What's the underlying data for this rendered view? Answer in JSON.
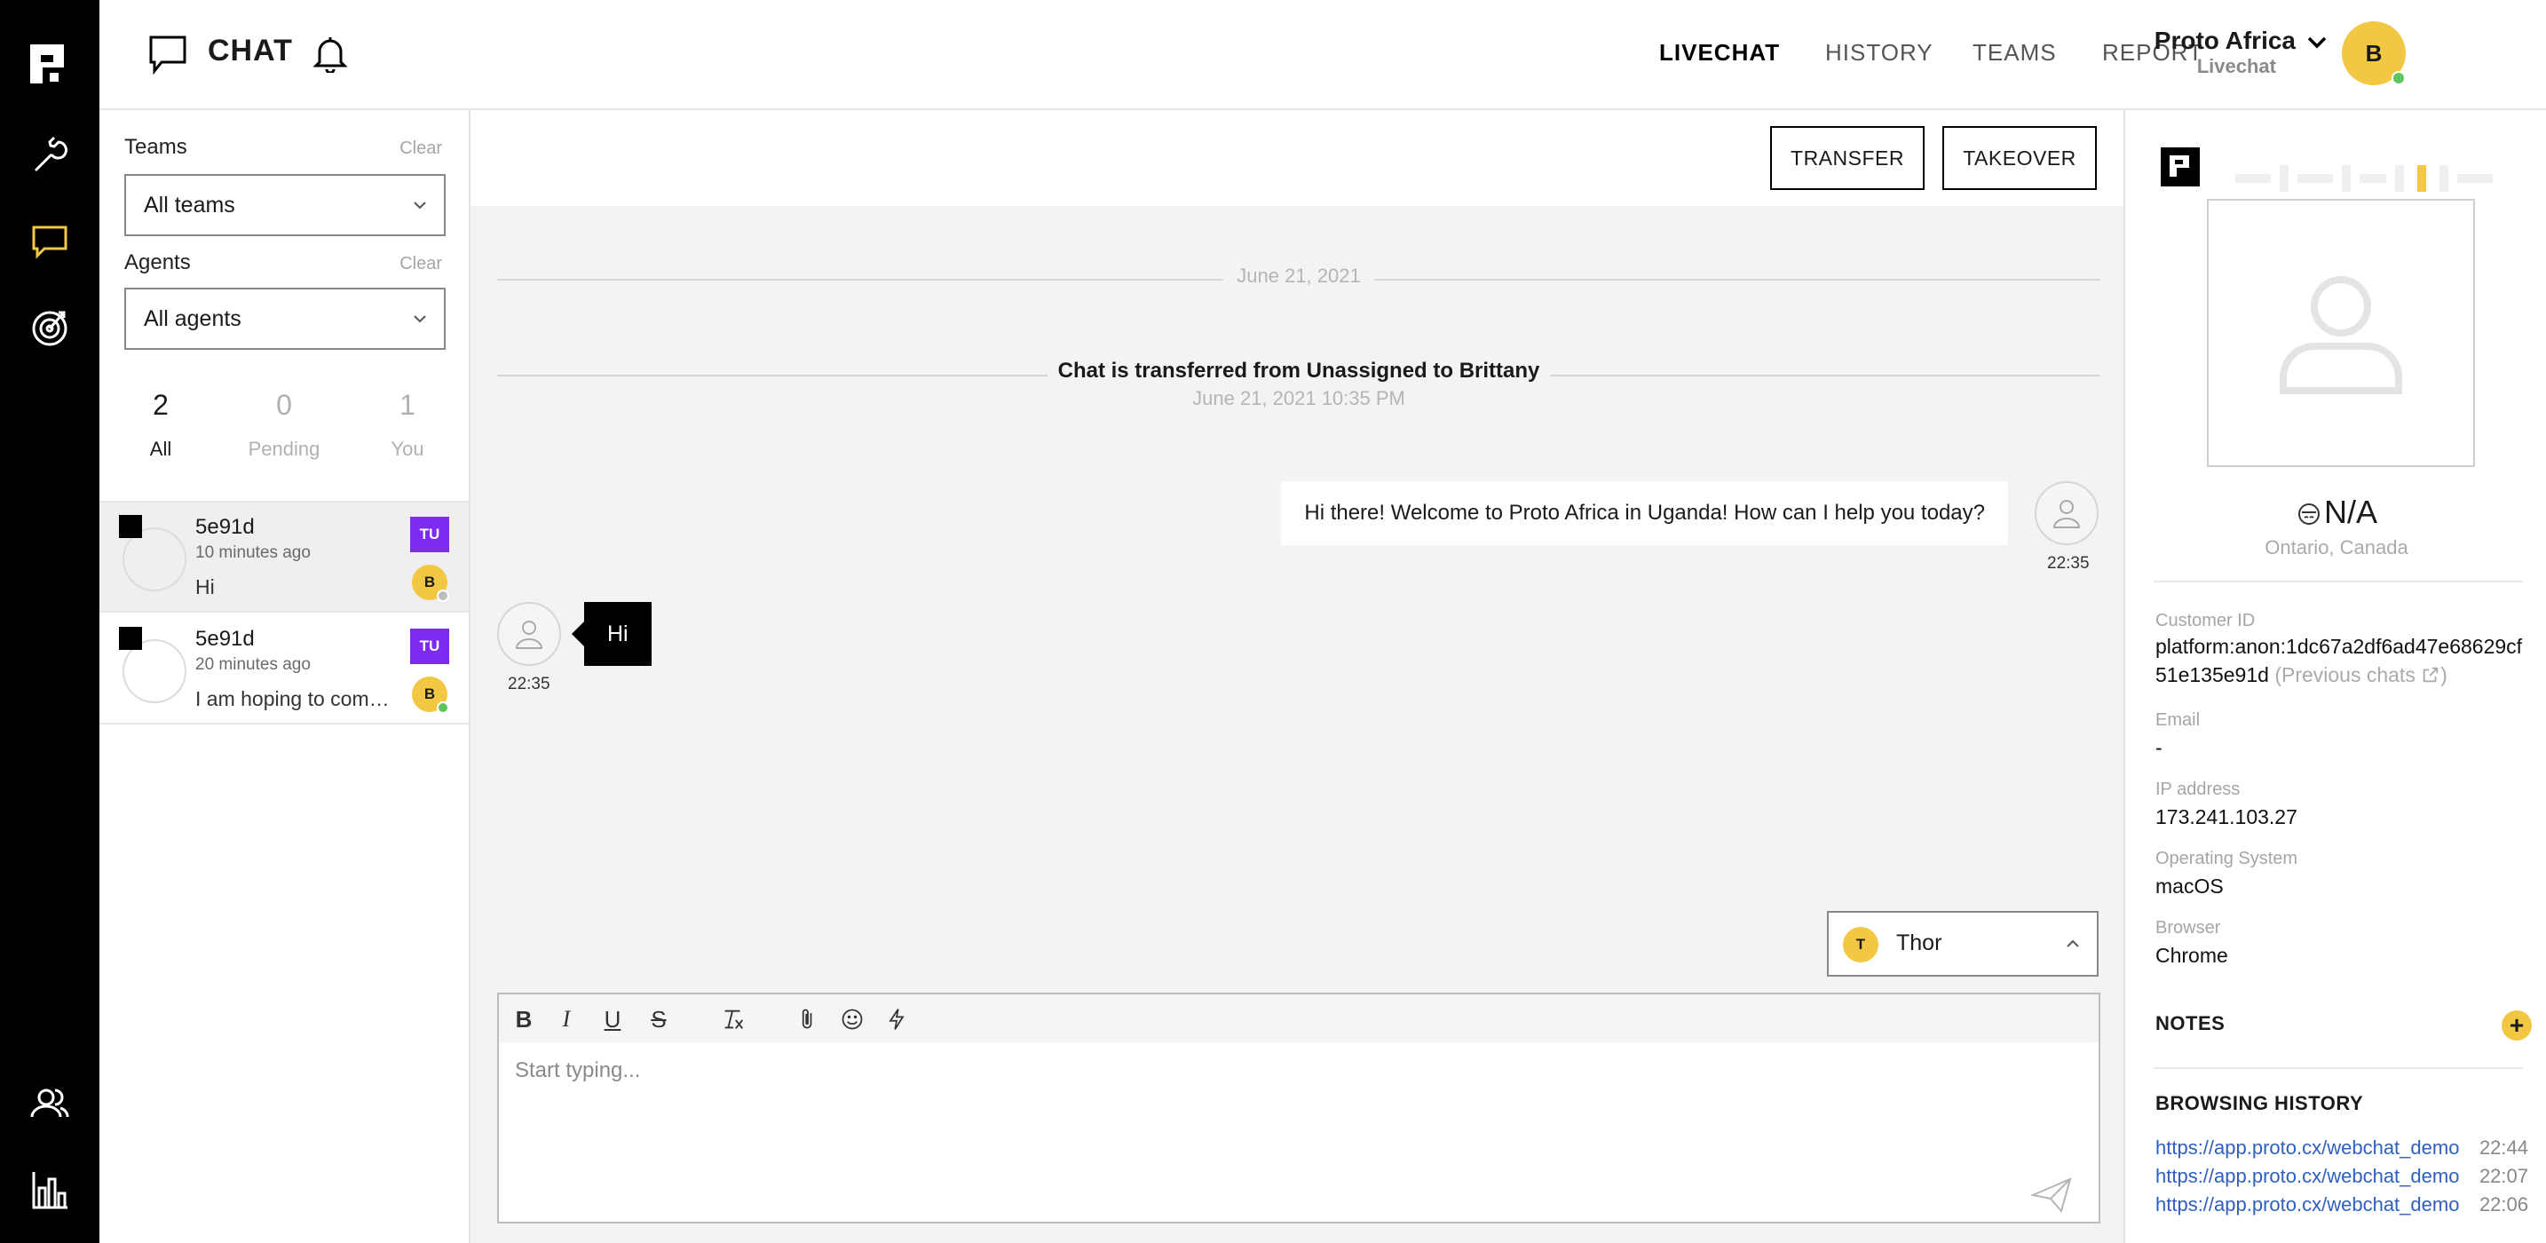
{
  "header": {
    "title": "CHAT",
    "nav": [
      "LIVECHAT",
      "HISTORY",
      "TEAMS",
      "REPORT"
    ],
    "org_name": "Proto Africa",
    "org_sub": "Livechat",
    "user_initial": "B"
  },
  "filters": {
    "teams_label": "Teams",
    "teams_clear": "Clear",
    "teams_value": "All teams",
    "agents_label": "Agents",
    "agents_clear": "Clear",
    "agents_value": "All agents",
    "counts": [
      {
        "num": "2",
        "label": "All"
      },
      {
        "num": "0",
        "label": "Pending"
      },
      {
        "num": "1",
        "label": "You"
      }
    ]
  },
  "conversations": [
    {
      "id": "5e91d",
      "time": "10 minutes ago",
      "preview": "Hi",
      "team": "TU",
      "agent": "B",
      "status_color": "#bdbdbd"
    },
    {
      "id": "5e91d",
      "time": "20 minutes ago",
      "preview": "I am hoping to come to Uganda",
      "team": "TU",
      "agent": "B",
      "status_color": "#5cc560"
    }
  ],
  "chat": {
    "transfer_label": "TRANSFER",
    "takeover_label": "TAKEOVER",
    "date": "June 21, 2021",
    "system_message": "Chat is transferred from Unassigned to Brittany",
    "system_date": "June 21, 2021 10:35 PM",
    "outgoing": {
      "text": "Hi there! Welcome to Proto Africa in Uganda! How can I help you today?",
      "time": "22:35"
    },
    "incoming": {
      "text": "Hi",
      "time": "22:35"
    },
    "assignee_initial": "T",
    "assignee_name": "Thor",
    "composer_placeholder": "Start typing..."
  },
  "customer": {
    "name": "N/A",
    "location": "Ontario, Canada",
    "customer_id_label": "Customer ID",
    "customer_id": "platform:anon:1dc67a2df6ad47e68629cf51e135e91d",
    "previous_chats": "(Previous chats",
    "email_label": "Email",
    "email": "-",
    "ip_label": "IP address",
    "ip": "173.241.103.27",
    "os_label": "Operating System",
    "os": "macOS",
    "browser_label": "Browser",
    "browser": "Chrome",
    "notes_label": "NOTES",
    "history_label": "BROWSING HISTORY",
    "history": [
      {
        "url": "https://app.proto.cx/webchat_demo",
        "time": "22:44"
      },
      {
        "url": "https://app.proto.cx/webchat_demo",
        "time": "22:07"
      },
      {
        "url": "https://app.proto.cx/webchat_demo",
        "time": "22:06"
      }
    ]
  }
}
